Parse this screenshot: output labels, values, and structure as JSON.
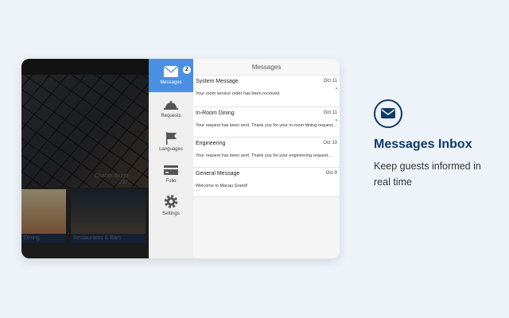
{
  "hero": {
    "guest_name": "Charlie Singh",
    "room": "237",
    "tiles": [
      "Dining",
      "Restaurants & Bars"
    ]
  },
  "sidebar": {
    "items": [
      {
        "label": "Messages",
        "icon": "envelope-icon",
        "badge": "2",
        "active": true
      },
      {
        "label": "Requests",
        "icon": "service-bell-icon"
      },
      {
        "label": "Languages",
        "icon": "flag-icon"
      },
      {
        "label": "Folio",
        "icon": "credit-card-icon"
      },
      {
        "label": "Settings",
        "icon": "gear-icon"
      }
    ]
  },
  "messages": {
    "title": "Messages",
    "items": [
      {
        "title": "System Message",
        "date": "Oct 11",
        "body": "Your room service order has been received.",
        "unread": true
      },
      {
        "title": "In-Room Dining",
        "date": "Oct 11",
        "body": "Your request has been sent. Thank you for your in-room dining request...",
        "unread": true
      },
      {
        "title": "Engineering",
        "date": "Oct 10",
        "body": "Your request has been sent. Thank you for your engineering request...",
        "unread": false
      },
      {
        "title": "General Message",
        "date": "Oct 9",
        "body": "Welcome to Macau Grand!",
        "extra": "\" \"",
        "unread": false
      }
    ]
  },
  "feature": {
    "title": "Messages Inbox",
    "text": "Keep guests informed in real time"
  },
  "colors": {
    "accent": "#4a90e2",
    "brand": "#0d3b66"
  }
}
